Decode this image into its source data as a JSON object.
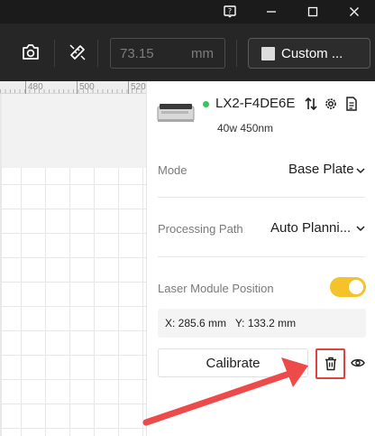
{
  "titlebar": {
    "icons": [
      "help-icon",
      "minimize-icon",
      "maximize-icon",
      "close-icon"
    ]
  },
  "toolbar": {
    "icons": [
      "camera-icon",
      "measure-icon"
    ],
    "size_value": "73.15",
    "size_unit": "mm",
    "custom_label": "Custom ..."
  },
  "canvas": {
    "ruler_labels": [
      "480",
      "500",
      "520"
    ]
  },
  "device": {
    "name": "LX2-F4DE6E",
    "spec": "40w 450nm",
    "status_color": "#34c759",
    "icons": [
      "swap-icon",
      "settings-icon",
      "document-icon"
    ]
  },
  "settings": {
    "mode_label": "Mode",
    "mode_value": "Base Plate",
    "path_label": "Processing Path",
    "path_value": "Auto Planni...",
    "laser_label": "Laser Module Position",
    "laser_toggle_on": true,
    "coords": "X: 285.6 mm   Y: 133.2 mm",
    "calibrate_label": "Calibrate"
  },
  "colors": {
    "accent_yellow": "#f4c22b",
    "highlight_red": "#e14141"
  }
}
